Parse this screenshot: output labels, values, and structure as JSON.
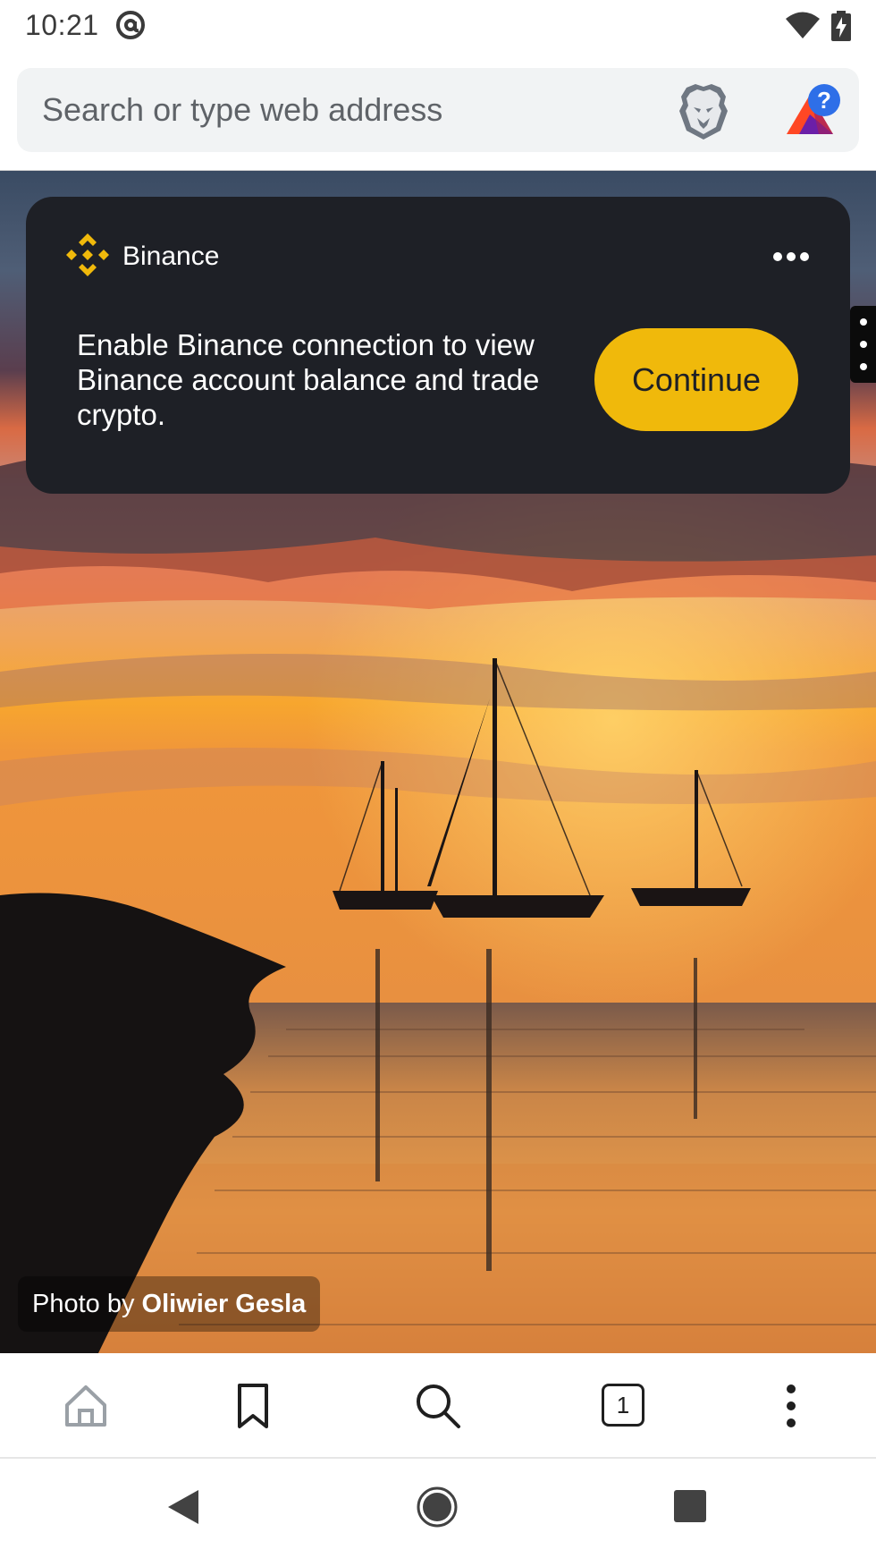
{
  "status_bar": {
    "time": "10:21",
    "icons": [
      "at-sign-icon",
      "wifi-icon",
      "battery-charging-icon"
    ]
  },
  "url_bar": {
    "placeholder": "Search or type web address",
    "value": "",
    "icons": [
      "brave-shields-icon",
      "brave-rewards-icon"
    ]
  },
  "binance_card": {
    "title": "Binance",
    "message": "Enable Binance connection to view Binance account balance and trade crypto.",
    "button_label": "Continue",
    "accent_color": "#f0b90b",
    "background_color": "#1e2026"
  },
  "background_photo": {
    "credit_prefix": "Photo by",
    "credit_author": "Oliwier Gesla"
  },
  "toolbar": {
    "tab_count": "1",
    "icons": [
      "home-icon",
      "bookmark-icon",
      "search-icon",
      "tabs-icon",
      "more-vert-icon"
    ]
  },
  "nav_bar": {
    "icons": [
      "back-icon",
      "home-circle-icon",
      "recents-icon"
    ]
  }
}
